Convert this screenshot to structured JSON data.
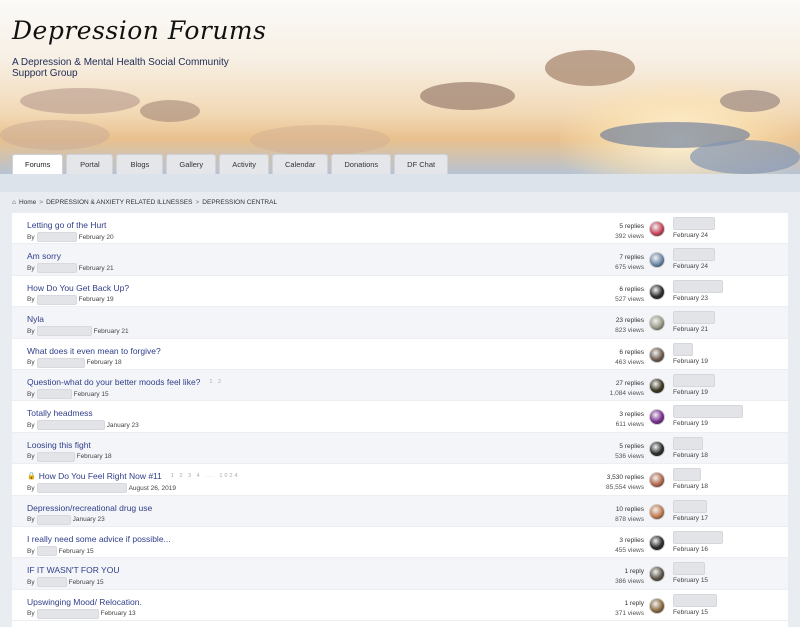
{
  "site": {
    "title": "Depression Forums",
    "tagline": "A Depression & Mental Health Social Community Support Group"
  },
  "tabs": [
    "Forums",
    "Portal",
    "Blogs",
    "Gallery",
    "Activity",
    "Calendar",
    "Donations",
    "DF Chat"
  ],
  "breadcrumb": {
    "home_icon": "home-icon",
    "home": "Home",
    "level1": "DEPRESSION & ANXIETY RELATED ILLNESSES",
    "level2": "DEPRESSION CENTRAL",
    "separator": ">"
  },
  "by_label": "By",
  "topics": [
    {
      "title": "Letting go of the Hurt",
      "started": "February 20",
      "replies": "5 replies",
      "views": "392 views",
      "last_date": "February 24",
      "avatar_color": "#c8455a",
      "locked": false,
      "pages": ""
    },
    {
      "title": "Am sorry",
      "started": "February 21",
      "replies": "7 replies",
      "views": "675 views",
      "last_date": "February 24",
      "avatar_color": "#6b87a8",
      "locked": false,
      "pages": ""
    },
    {
      "title": "How Do You Get Back Up?",
      "started": "February 19",
      "replies": "6 replies",
      "views": "527 views",
      "last_date": "February 23",
      "avatar_color": "#2b2b2b",
      "locked": false,
      "pages": ""
    },
    {
      "title": "Nyla",
      "started": "February 21",
      "replies": "23 replies",
      "views": "823 views",
      "last_date": "February 21",
      "avatar_color": "#9a9a88",
      "locked": false,
      "pages": ""
    },
    {
      "title": "What does it even mean to forgive?",
      "started": "February 18",
      "replies": "6 replies",
      "views": "463 views",
      "last_date": "February 19",
      "avatar_color": "#6e5c4e",
      "locked": false,
      "pages": ""
    },
    {
      "title": "Question-what do your better moods feel like?",
      "started": "February 15",
      "replies": "27 replies",
      "views": "1,084 views",
      "last_date": "February 19",
      "avatar_color": "#3a3520",
      "locked": false,
      "pages": "1 2"
    },
    {
      "title": "Totally headmess",
      "started": "January 23",
      "replies": "3 replies",
      "views": "611 views",
      "last_date": "February 19",
      "avatar_color": "#7a2e8f",
      "locked": false,
      "pages": ""
    },
    {
      "title": "Loosing this fight",
      "started": "February 18",
      "replies": "5 replies",
      "views": "536 views",
      "last_date": "February 18",
      "avatar_color": "#2b2b2b",
      "locked": false,
      "pages": ""
    },
    {
      "title": "How Do You Feel Right Now #11",
      "started": "August 26, 2019",
      "replies": "3,530 replies",
      "views": "85,554 views",
      "last_date": "February 18",
      "avatar_color": "#b2684a",
      "locked": true,
      "pages": "1 2 3 4 ... 1024"
    },
    {
      "title": "Depression/recreational drug use",
      "started": "January 23",
      "replies": "10 replies",
      "views": "878 views",
      "last_date": "February 17",
      "avatar_color": "#c27a4f",
      "locked": false,
      "pages": ""
    },
    {
      "title": "I really need some advice if possible...",
      "started": "February 15",
      "replies": "3 replies",
      "views": "455 views",
      "last_date": "February 16",
      "avatar_color": "#2b2b2b",
      "locked": false,
      "pages": ""
    },
    {
      "title": "IF IT WASN'T FOR YOU",
      "started": "February 15",
      "replies": "1 reply",
      "views": "386 views",
      "last_date": "February 15",
      "avatar_color": "#5a5448",
      "locked": false,
      "pages": ""
    },
    {
      "title": "Upswinging Mood/ Relocation.",
      "started": "February 13",
      "replies": "1 reply",
      "views": "371 views",
      "last_date": "February 15",
      "avatar_color": "#8a6a3e",
      "locked": false,
      "pages": ""
    }
  ]
}
